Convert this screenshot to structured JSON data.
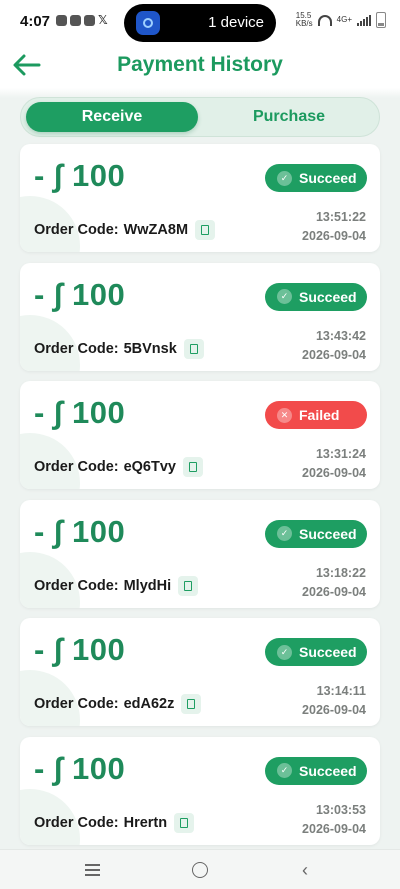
{
  "status_bar": {
    "time": "4:07",
    "island_text": "1 device",
    "net_speed": "15.5",
    "net_unit": "KB/s",
    "network_type": "4G+",
    "icons": [
      "facebook-icon",
      "gmail-icon",
      "capcut-icon",
      "x-icon",
      "wifi-icon",
      "signal-icon",
      "battery-icon"
    ]
  },
  "header": {
    "title": "Payment History",
    "back_icon": "arrow-left-icon"
  },
  "tabs": {
    "receive": "Receive",
    "purchase": "Purchase",
    "active": "Receive"
  },
  "orders": [
    {
      "amount": "- ∫ 100",
      "status": "Succeed",
      "order_label": "Order Code:",
      "order_code": "WwZA8M",
      "time": "13:51:22",
      "date": "2026-09-04"
    },
    {
      "amount": "- ∫ 100",
      "status": "Succeed",
      "order_label": "Order Code:",
      "order_code": "5BVnsk",
      "time": "13:43:42",
      "date": "2026-09-04"
    },
    {
      "amount": "- ∫ 100",
      "status": "Failed",
      "order_label": "Order Code:",
      "order_code": "eQ6Tvy",
      "time": "13:31:24",
      "date": "2026-09-04"
    },
    {
      "amount": "- ∫ 100",
      "status": "Succeed",
      "order_label": "Order Code:",
      "order_code": "MlydHi",
      "time": "13:18:22",
      "date": "2026-09-04"
    },
    {
      "amount": "- ∫ 100",
      "status": "Succeed",
      "order_label": "Order Code:",
      "order_code": "edA62z",
      "time": "13:14:11",
      "date": "2026-09-04"
    },
    {
      "amount": "- ∫ 100",
      "status": "Succeed",
      "order_label": "Order Code:",
      "order_code": "Hrertn",
      "time": "13:03:53",
      "date": "2026-09-04"
    }
  ],
  "colors": {
    "accent": "#1e9e62",
    "success": "#1e9e62",
    "failed": "#f24b4b",
    "amount": "#1f8a5a"
  }
}
